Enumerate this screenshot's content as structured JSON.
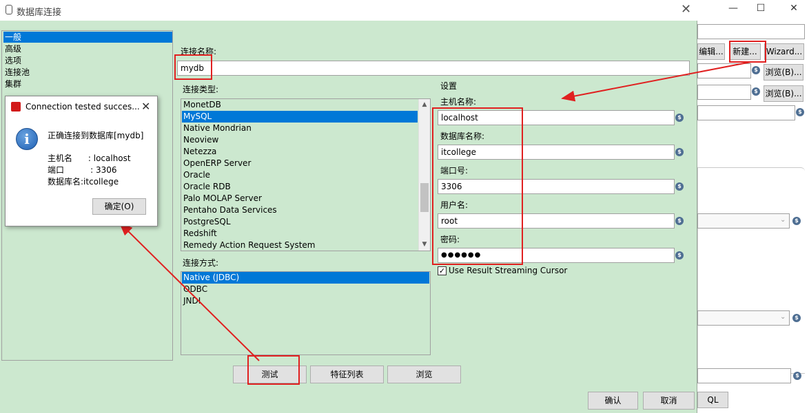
{
  "dialog": {
    "title": "数据库连接",
    "close_glyph": "✕"
  },
  "left_nav": {
    "items": [
      "一般",
      "高级",
      "选项",
      "连接池",
      "集群"
    ]
  },
  "connection": {
    "name_label": "连接名称:",
    "name_value": "mydb",
    "type_label": "连接类型:",
    "types": [
      "MonetDB",
      "MySQL",
      "Native Mondrian",
      "Neoview",
      "Netezza",
      "OpenERP Server",
      "Oracle",
      "Oracle RDB",
      "Palo MOLAP Server",
      "Pentaho Data Services",
      "PostgreSQL",
      "Redshift",
      "Remedy Action Request System"
    ],
    "selected_type": "MySQL",
    "access_label": "连接方式:",
    "access_methods": [
      "Native (JDBC)",
      "ODBC",
      "JNDI"
    ],
    "selected_access": "Native (JDBC)"
  },
  "settings": {
    "section_label": "设置",
    "host_label": "主机名称:",
    "host_value": "localhost",
    "db_label": "数据库名称:",
    "db_value": "itcollege",
    "port_label": "端口号:",
    "port_value": "3306",
    "user_label": "用户名:",
    "user_value": "root",
    "password_label": "密码:",
    "password_value": "●●●●●●",
    "streaming_label": "Use Result Streaming Cursor",
    "streaming_checked": true
  },
  "buttons": {
    "test": "测试",
    "features": "特征列表",
    "browse": "浏览",
    "ok": "确认",
    "cancel": "取消"
  },
  "message_box": {
    "title": "Connection tested succes...",
    "close_glyph": "✕",
    "info_glyph": "i",
    "line1": "正确连接到数据库[mydb]",
    "line2": "主机名      : localhost",
    "line3": "端口          : 3306",
    "line4": "数据库名:itcollege",
    "ok_button": "确定(O)"
  },
  "background_window": {
    "minimize_glyph": "—",
    "maximize_glyph": "☐",
    "close_glyph": "✕",
    "edit_button": "编辑...",
    "new_button": "新建...",
    "wizard_button": "Wizard...",
    "browse_button_1": "浏览(B)...",
    "browse_button_2": "浏览(B)...",
    "sql_fragment": "QL"
  },
  "colors": {
    "dialog_bg": "#cce8cf",
    "selection": "#0078d7",
    "annotation_red": "#e02020"
  }
}
